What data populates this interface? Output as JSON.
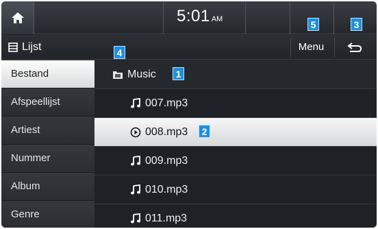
{
  "status": {
    "time": "5:01",
    "ampm": "AM"
  },
  "titlebar": {
    "title": "Lijst",
    "menu_label": "Menu"
  },
  "callouts": {
    "back": "3",
    "list_header": "4",
    "menu": "5",
    "folder": "1",
    "selected": "2"
  },
  "sidebar": {
    "items": [
      {
        "label": "Bestand",
        "active": true
      },
      {
        "label": "Afspeellijst",
        "active": false
      },
      {
        "label": "Artiest",
        "active": false
      },
      {
        "label": "Nummer",
        "active": false
      },
      {
        "label": "Album",
        "active": false
      },
      {
        "label": "Genre",
        "active": false
      }
    ]
  },
  "list": {
    "folder": "Music",
    "files": [
      {
        "name": "007.mp3",
        "icon": "music-note-icon",
        "playing": false
      },
      {
        "name": "008.mp3",
        "icon": "play-circle-icon",
        "playing": true
      },
      {
        "name": "009.mp3",
        "icon": "music-note-icon",
        "playing": false
      },
      {
        "name": "010.mp3",
        "icon": "music-note-icon",
        "playing": false
      },
      {
        "name": "011.mp3",
        "icon": "music-note-icon",
        "playing": false
      }
    ]
  },
  "colors": {
    "callout": "#1f8fe0",
    "background": "#1f2226",
    "selection": "#e6e7e9"
  }
}
